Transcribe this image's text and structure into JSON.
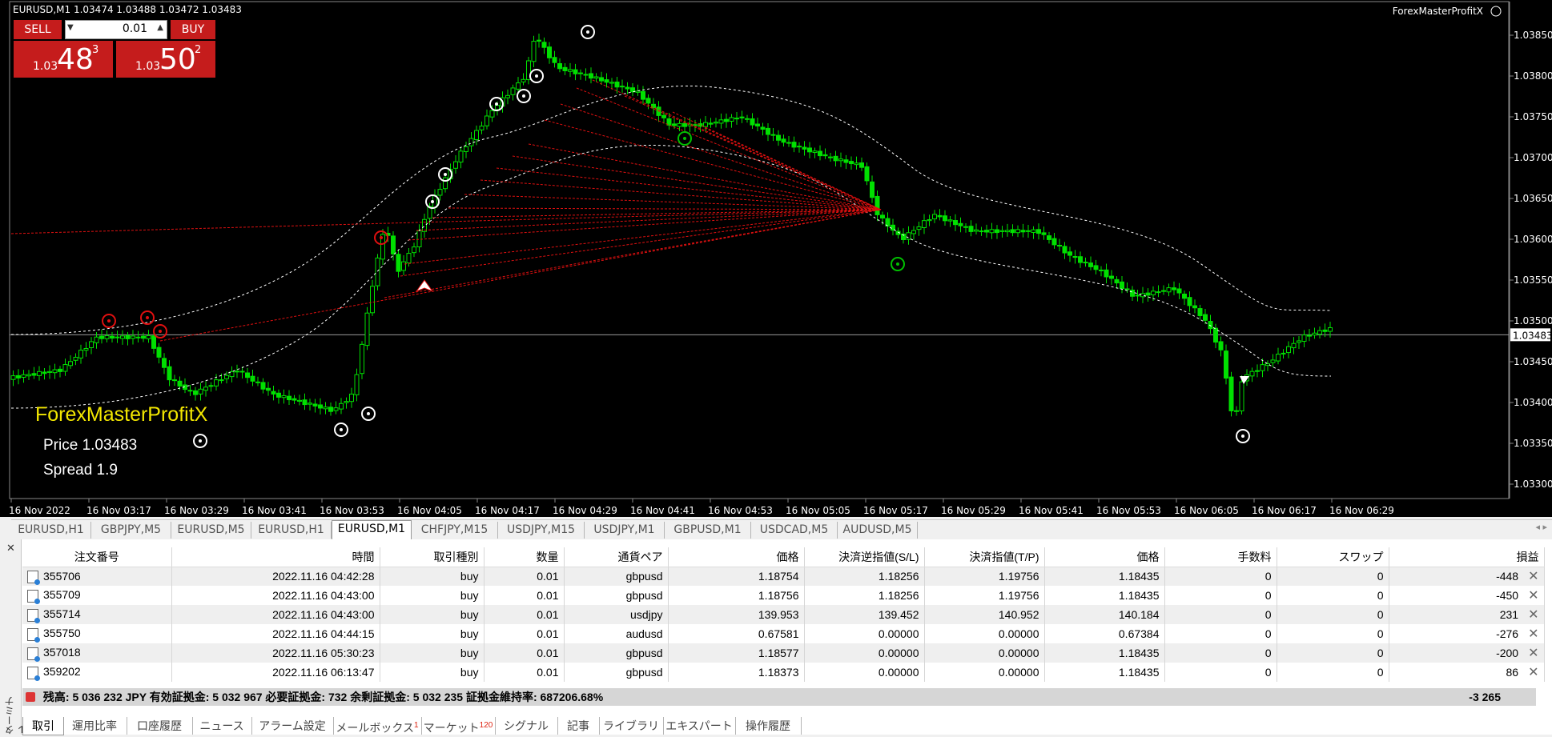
{
  "chart": {
    "header": "EURUSD,M1  1.03474 1.03488 1.03472 1.03483",
    "expert_label": "ForexMasterProfitX",
    "price_line_label": "1.03483",
    "y_ticks": [
      "1.03850",
      "1.03800",
      "1.03750",
      "1.03700",
      "1.03650",
      "1.03600",
      "1.03550",
      "1.03500",
      "1.03450",
      "1.03400",
      "1.03350",
      "1.03300"
    ],
    "x_ticks": [
      "16 Nov 2022",
      "16 Nov 03:17",
      "16 Nov 03:29",
      "16 Nov 03:41",
      "16 Nov 03:53",
      "16 Nov 04:05",
      "16 Nov 04:17",
      "16 Nov 04:29",
      "16 Nov 04:41",
      "16 Nov 04:53",
      "16 Nov 05:05",
      "16 Nov 05:17",
      "16 Nov 05:29",
      "16 Nov 05:41",
      "16 Nov 05:53",
      "16 Nov 06:05",
      "16 Nov 06:17",
      "16 Nov 06:29"
    ],
    "colors": {
      "background": "#000000",
      "bull_candle": "#00e000",
      "line": "#ffffff",
      "signal_red": "#e01010",
      "signal_green": "#00c000"
    }
  },
  "trade_panel": {
    "sell_label": "SELL",
    "buy_label": "BUY",
    "lot": "0.01",
    "sell_small": "1.03",
    "sell_big": "48",
    "sell_sup": "3",
    "buy_small": "1.03",
    "buy_big": "50",
    "buy_sup": "2"
  },
  "indicator": {
    "title": "ForexMasterProfitX",
    "price_line": "Price  1.03483",
    "spread_line": "Spread  1.9"
  },
  "symbol_tabs": [
    "EURUSD,H1",
    "GBPJPY,M5",
    "EURUSD,M5",
    "EURUSD,H1",
    "EURUSD,M1",
    "CHFJPY,M15",
    "USDJPY,M15",
    "USDJPY,M1",
    "GBPUSD,M1",
    "USDCAD,M5",
    "AUDUSD,M5"
  ],
  "active_symbol_tab": "EURUSD,M1",
  "terminal": {
    "side_label": "ターミナル",
    "columns": [
      "注文番号",
      "時間",
      "取引種別",
      "数量",
      "通貨ペア",
      "価格",
      "決済逆指値(S/L)",
      "決済指値(T/P)",
      "価格",
      "手数料",
      "スワップ",
      "損益"
    ],
    "rows": [
      {
        "ticket": "355706",
        "time": "2022.11.16 04:42:28",
        "type": "buy",
        "size": "0.01",
        "symbol": "gbpusd",
        "price": "1.18754",
        "sl": "1.18256",
        "tp": "1.19756",
        "cur": "1.18435",
        "commission": "0",
        "swap": "0",
        "profit": "-448"
      },
      {
        "ticket": "355709",
        "time": "2022.11.16 04:43:00",
        "type": "buy",
        "size": "0.01",
        "symbol": "gbpusd",
        "price": "1.18756",
        "sl": "1.18256",
        "tp": "1.19756",
        "cur": "1.18435",
        "commission": "0",
        "swap": "0",
        "profit": "-450"
      },
      {
        "ticket": "355714",
        "time": "2022.11.16 04:43:00",
        "type": "buy",
        "size": "0.01",
        "symbol": "usdjpy",
        "price": "139.953",
        "sl": "139.452",
        "tp": "140.952",
        "cur": "140.184",
        "commission": "0",
        "swap": "0",
        "profit": "231"
      },
      {
        "ticket": "355750",
        "time": "2022.11.16 04:44:15",
        "type": "buy",
        "size": "0.01",
        "symbol": "audusd",
        "price": "0.67581",
        "sl": "0.00000",
        "tp": "0.00000",
        "cur": "0.67384",
        "commission": "0",
        "swap": "0",
        "profit": "-276"
      },
      {
        "ticket": "357018",
        "time": "2022.11.16 05:30:23",
        "type": "buy",
        "size": "0.01",
        "symbol": "gbpusd",
        "price": "1.18577",
        "sl": "0.00000",
        "tp": "0.00000",
        "cur": "1.18435",
        "commission": "0",
        "swap": "0",
        "profit": "-200"
      },
      {
        "ticket": "359202",
        "time": "2022.11.16 06:13:47",
        "type": "buy",
        "size": "0.01",
        "symbol": "gbpusd",
        "price": "1.18373",
        "sl": "0.00000",
        "tp": "0.00000",
        "cur": "1.18435",
        "commission": "0",
        "swap": "0",
        "profit": "86"
      }
    ],
    "summary_text": "残高: 5 036 232 JPY  有効証拠金: 5 032 967  必要証拠金: 732  余剰証拠金: 5 032 235  証拠金維持率: 687206.68%",
    "summary_total": "-3 265",
    "bottom_tabs": [
      {
        "label": "取引",
        "badge": ""
      },
      {
        "label": "運用比率",
        "badge": ""
      },
      {
        "label": "口座履歴",
        "badge": ""
      },
      {
        "label": "ニュース",
        "badge": ""
      },
      {
        "label": "アラーム設定",
        "badge": ""
      },
      {
        "label": "メールボックス",
        "badge": "1"
      },
      {
        "label": "マーケット",
        "badge": "120"
      },
      {
        "label": "シグナル",
        "badge": ""
      },
      {
        "label": "記事",
        "badge": ""
      },
      {
        "label": "ライブラリ",
        "badge": ""
      },
      {
        "label": "エキスパート",
        "badge": ""
      },
      {
        "label": "操作履歴",
        "badge": ""
      }
    ]
  }
}
